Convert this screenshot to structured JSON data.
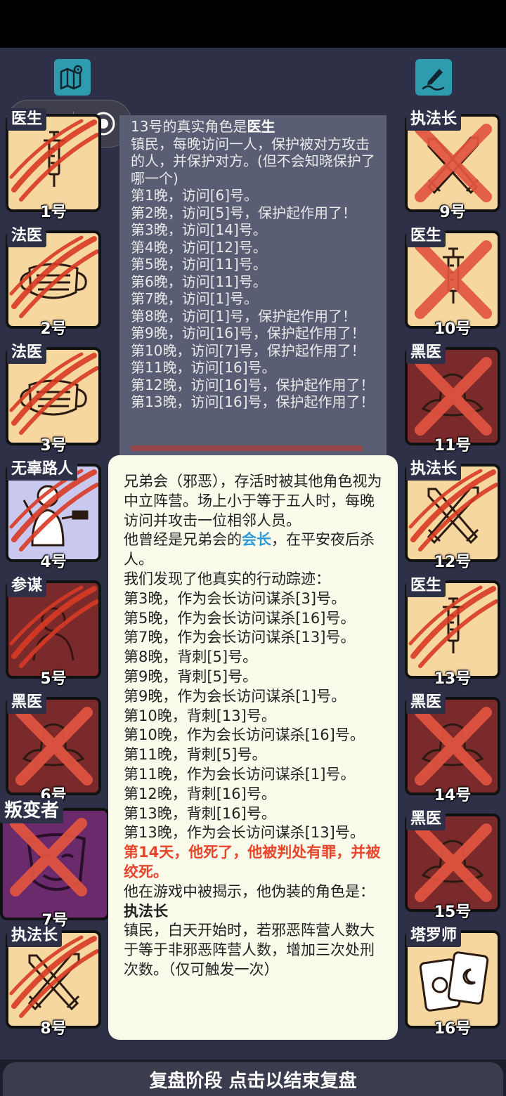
{
  "footer": {
    "label": "复盘阶段 点击以结束复盘"
  },
  "toolbar": {
    "map_icon": "map-icon",
    "note_icon": "pen-note-icon"
  },
  "colors": {
    "scratch": "#d83a24",
    "cross": "#e25540",
    "board_bg": "#2e3048",
    "link": "#2f9ad8",
    "alert": "#e8452b"
  },
  "players": [
    {
      "number": "1号",
      "role": "医生",
      "art": "syringe",
      "status": "scratched",
      "bg": "tan"
    },
    {
      "number": "2号",
      "role": "法医",
      "art": "mask",
      "status": "scratched",
      "bg": "tan"
    },
    {
      "number": "3号",
      "role": "法医",
      "art": "mask",
      "status": "scratched",
      "bg": "tan"
    },
    {
      "number": "4号",
      "role": "无辜路人",
      "art": "bystander",
      "status": "scratched",
      "bg": "lavender"
    },
    {
      "number": "5号",
      "role": "参谋",
      "art": "strategist",
      "status": "scratched",
      "bg": "dark"
    },
    {
      "number": "6号",
      "role": "黑医",
      "art": "hat",
      "status": "crossed",
      "bg": "dark"
    },
    {
      "number": "7号",
      "role": "叛变者",
      "art": "theater-mask",
      "status": "crossed",
      "bg": "purple"
    },
    {
      "number": "8号",
      "role": "执法长",
      "art": "swords",
      "status": "scratched",
      "bg": "tan"
    },
    {
      "number": "9号",
      "role": "执法长",
      "art": "swords",
      "status": "crossed",
      "bg": "tan"
    },
    {
      "number": "10号",
      "role": "医生",
      "art": "syringe",
      "status": "crossed",
      "bg": "tan"
    },
    {
      "number": "11号",
      "role": "黑医",
      "art": "hat",
      "status": "crossed",
      "bg": "dark"
    },
    {
      "number": "12号",
      "role": "执法长",
      "art": "swords",
      "status": "scratched",
      "bg": "tan"
    },
    {
      "number": "13号",
      "role": "医生",
      "art": "syringe",
      "status": "scratched",
      "bg": "tan"
    },
    {
      "number": "14号",
      "role": "黑医",
      "art": "hat",
      "status": "crossed",
      "bg": "dark"
    },
    {
      "number": "15号",
      "role": "黑医",
      "art": "hat",
      "status": "crossed",
      "bg": "dark"
    },
    {
      "number": "16号",
      "role": "塔罗师",
      "art": "tarot",
      "status": "alive",
      "bg": "tan"
    }
  ],
  "log_panel": {
    "title_prefix": "13号的真实角色是",
    "title_role": "医生",
    "description": "镇民，每晚访问一人，保护被对方攻击的人，并保护对方。(但不会知晓保护了哪一个)",
    "entries": [
      "第1晚，访问[6]号。",
      "第2晚，访问[5]号，保护起作用了！",
      "第3晚，访问[14]号。",
      "第4晚，访问[12]号。",
      "第5晚，访问[11]号。",
      "第6晚，访问[11]号。",
      "第7晚，访问[1]号。",
      "第8晚，访问[1]号，保护起作用了！",
      "第9晚，访问[16]号，保护起作用了！",
      "第10晚，访问[7]号，保护起作用了！",
      "第11晚，访问[16]号。",
      "第12晚，访问[16]号，保护起作用了！",
      "第13晚，访问[16]号，保护起作用了！"
    ]
  },
  "popup": {
    "intro": "兄弟会（邪恶），存活时被其他角色视为中立阵营。场上小于等于五人时，每晚访问并攻击一位相邻人员。",
    "past_prefix": "他曾经是兄弟会的",
    "past_role": "会长",
    "past_suffix": "，在平安夜后杀人。",
    "traces_header": "我们发现了他真实的行动踪迹：",
    "traces": [
      "第3晚，作为会长访问谋杀[3]号。",
      "第5晚，作为会长访问谋杀[16]号。",
      "第7晚，作为会长访问谋杀[13]号。",
      "第8晚，背刺[5]号。",
      "第9晚，背刺[5]号。",
      "第9晚，作为会长访问谋杀[1]号。",
      "第10晚，背刺[13]号。",
      "第10晚，作为会长访问谋杀[16]号。",
      "第11晚，背刺[5]号。",
      "第11晚，作为会长访问谋杀[1]号。",
      "第12晚，背刺[16]号。",
      "第13晚，背刺[16]号。",
      "第13晚，作为会长访问谋杀[13]号。"
    ],
    "death": "第14天，他死了，他被判处有罪，并被绞死。",
    "reveal_prefix": "他在游戏中被揭示，他伪装的角色是：",
    "reveal_role": "执法长",
    "reveal_desc": "镇民，白天开始时，若邪恶阵营人数大于等于非邪恶阵营人数，增加三次处刑次数。（仅可触发一次）"
  }
}
